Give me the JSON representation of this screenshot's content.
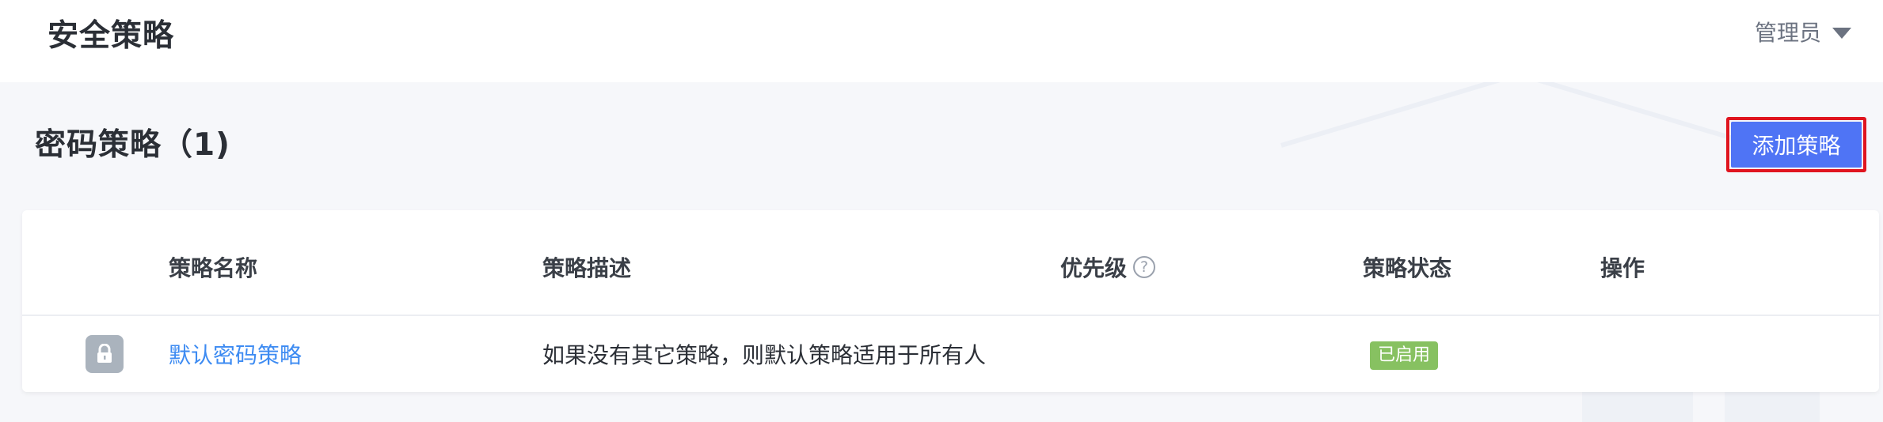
{
  "header": {
    "title": "安全策略",
    "user_label": "管理员"
  },
  "section": {
    "title": "密码策略（1)",
    "add_button_label": "添加策略"
  },
  "table": {
    "columns": [
      "策略名称",
      "策略描述",
      "优先级",
      "策略状态",
      "操作"
    ],
    "priority_help": "?",
    "rows": [
      {
        "name": "默认密码策略",
        "description": "如果没有其它策略，则默认策略适用于所有人",
        "priority": "",
        "status": "已启用",
        "actions": ""
      }
    ]
  },
  "colors": {
    "primary": "#4f74f5",
    "highlight_border": "#e0151f",
    "link": "#3d8bf2",
    "status_enabled": "#87c161"
  },
  "icons": {
    "row_icon": "lock-icon",
    "user_menu_caret": "caret-down-icon",
    "priority_help": "help-icon"
  }
}
